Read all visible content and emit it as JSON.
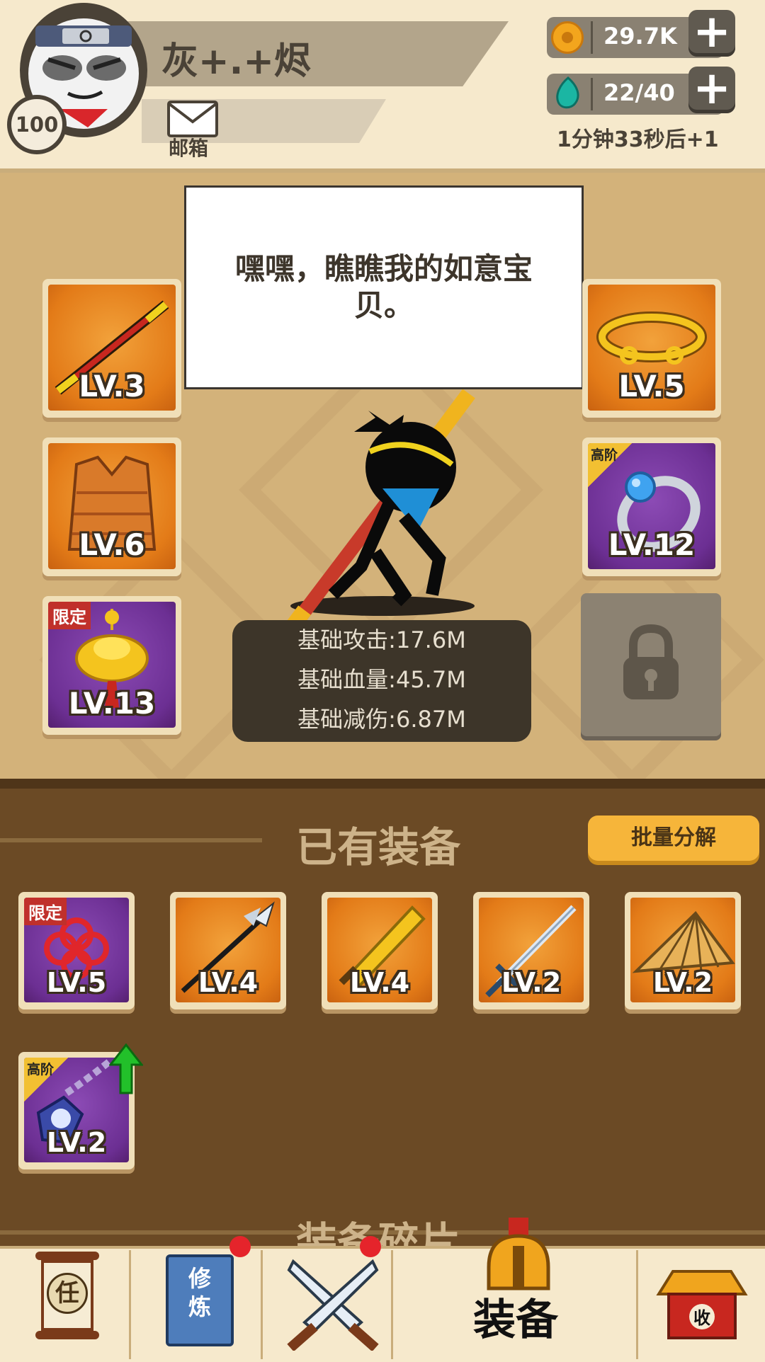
{
  "player": {
    "name": "灰+.+烬",
    "level": "100",
    "mail_label": "邮箱"
  },
  "resources": {
    "coins": "29.7K",
    "energy": "22/40",
    "timer": "1分钟33秒后+1"
  },
  "speech": "嘿嘿，瞧瞧我的如意宝贝。",
  "equipped": {
    "left": [
      {
        "level": "LV.3",
        "item": "staff",
        "rarity": "orange"
      },
      {
        "level": "LV.6",
        "item": "armor-vest",
        "rarity": "orange"
      },
      {
        "level": "LV.13",
        "item": "gold-ingot-charm",
        "rarity": "purple",
        "tag": "限定"
      }
    ],
    "right": [
      {
        "level": "LV.5",
        "item": "golden-headband",
        "rarity": "orange"
      },
      {
        "level": "LV.12",
        "item": "blue-gem-ring",
        "rarity": "purple",
        "tag": "高阶"
      },
      {
        "locked": true,
        "item": "lock"
      }
    ]
  },
  "stats": [
    "基础攻击:17.6M",
    "基础血量:45.7M",
    "基础减伤:6.87M"
  ],
  "inventory": {
    "title": "已有装备",
    "decompose_label": "批量分解",
    "items": [
      {
        "level": "LV.5",
        "item": "chinese-knot",
        "rarity": "purple",
        "tag": "限定"
      },
      {
        "level": "LV.4",
        "item": "trident-spear",
        "rarity": "orange"
      },
      {
        "level": "LV.4",
        "item": "golden-broadsword",
        "rarity": "orange"
      },
      {
        "level": "LV.2",
        "item": "steel-sword",
        "rarity": "orange"
      },
      {
        "level": "LV.2",
        "item": "bamboo-hat",
        "rarity": "orange"
      },
      {
        "level": "LV.2",
        "item": "gem-amulet",
        "rarity": "purple",
        "tag": "高阶",
        "upgrade": true
      }
    ]
  },
  "fragments_title": "装备碎片",
  "nav": {
    "task_char": "任",
    "train_chars": "修炼",
    "equip_label": "装备",
    "collect_char": "收"
  },
  "colors": {
    "orange": "#e37b18",
    "purple": "#6c2f93",
    "accent": "#f6b53a",
    "panel": "#6b4a25"
  }
}
